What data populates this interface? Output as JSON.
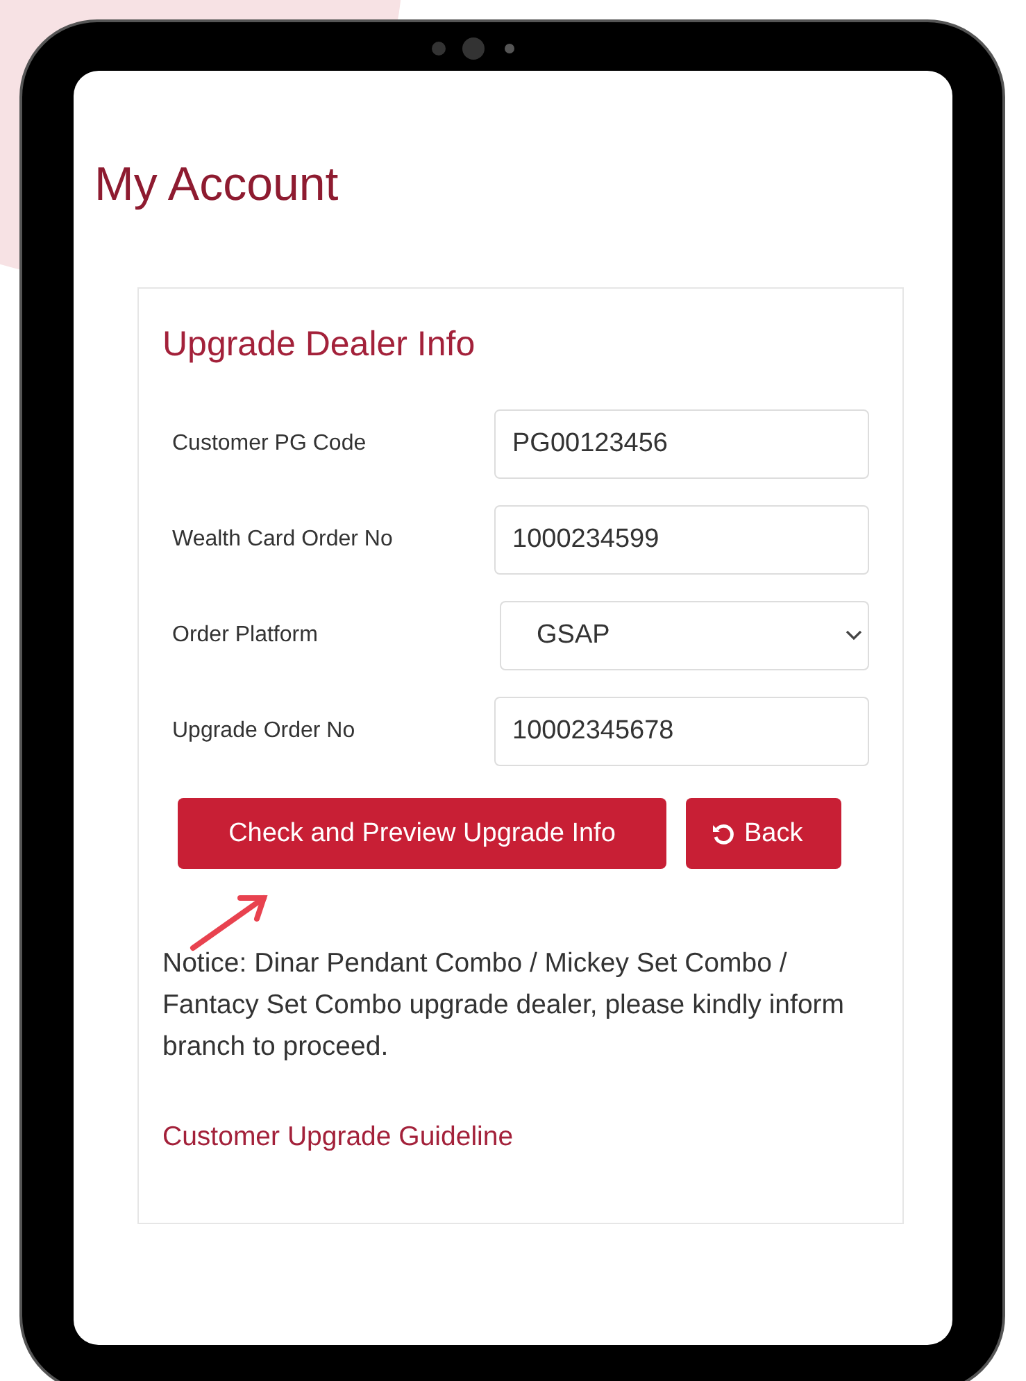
{
  "page": {
    "title": "My Account"
  },
  "form": {
    "title": "Upgrade Dealer Info",
    "fields": [
      {
        "kind": "text",
        "label": "Customer PG Code",
        "value": "PG00123456"
      },
      {
        "kind": "text",
        "label": "Wealth Card Order No",
        "value": "1000234599"
      },
      {
        "kind": "select",
        "label": "Order Platform",
        "value": "GSAP"
      },
      {
        "kind": "text",
        "label": "Upgrade Order No",
        "value": "10002345678"
      }
    ],
    "buttons": [
      {
        "kind": "primary",
        "label": "Check and Preview Upgrade Info"
      },
      {
        "kind": "back",
        "label": "Back"
      }
    ],
    "notice": "Notice: Dinar Pendant Combo / Mickey Set Combo / Fantacy Set Combo upgrade dealer, please kindly inform branch to proceed.",
    "link": "Customer Upgrade Guideline"
  }
}
